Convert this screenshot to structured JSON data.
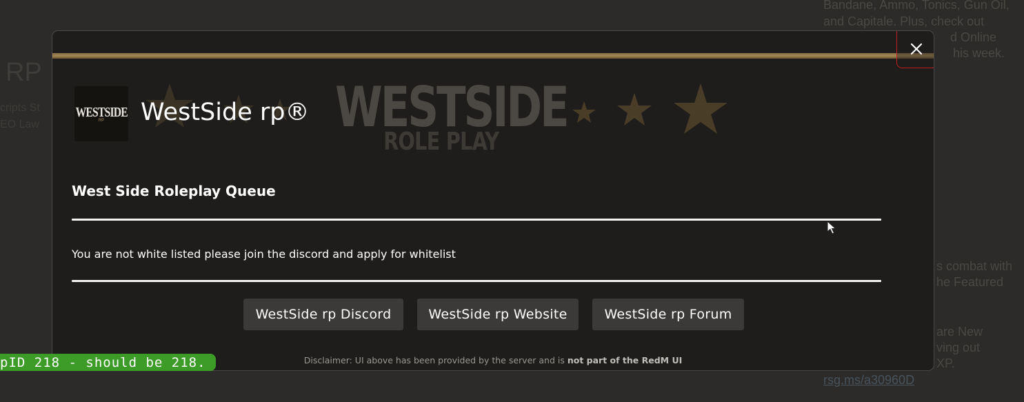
{
  "background": {
    "left_title": "RP",
    "left_lines": [
      "cripts St",
      "EO Law"
    ],
    "right_lines_top": [
      "Bandane, Ammo, Tonics, Gun Oil,",
      "and Capitale. Plus, check out",
      "d Online",
      "his week."
    ],
    "right_lines_mid": [
      "s combat with",
      "he Featured"
    ],
    "right_lines_low": [
      "are New",
      "ving out",
      "XP."
    ],
    "right_link": "rsg.ms/a30960D"
  },
  "modal": {
    "close_icon": "close-icon",
    "server_logo": {
      "text": "WESTSIDE",
      "sub": "RP"
    },
    "server_name": "WestSide rp®",
    "banner": {
      "logo_text": "WESTSIDE",
      "logo_sub": "ROLE PLAY"
    },
    "queue_title": "West Side Roleplay Queue",
    "queue_message": "You are not white listed please join the discord and apply for whitelist",
    "buttons": [
      {
        "label": "WestSide rp Discord"
      },
      {
        "label": "WestSide rp Website"
      },
      {
        "label": "WestSide rp Forum"
      }
    ],
    "disclaimer_prefix": "Disclaimer: UI above has been provided by the server and is ",
    "disclaimer_bold": "not part of the RedM UI"
  },
  "debug_overlay": "pID 218 - should be 218.",
  "colors": {
    "modal_bg": "#1f1d1b",
    "gold_bar": "#a28654",
    "close_border": "#c11f22",
    "button_bg": "#3b3a38",
    "debug_bg": "#3d9b28"
  }
}
